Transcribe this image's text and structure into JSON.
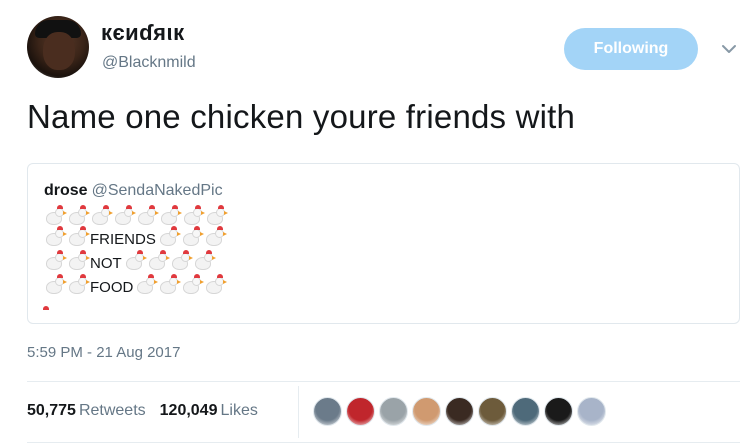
{
  "tweet": {
    "display_name": "кєиɗяιк",
    "handle": "@Blacknmild",
    "follow_label": "Following",
    "text": "Name one chicken youre friends with",
    "timestamp": "5:59 PM - 21 Aug 2017"
  },
  "quoted_tweet": {
    "name": "drose",
    "handle": "@SendaNakedPic",
    "words": [
      "FRIENDS",
      "NOT",
      "FOOD"
    ],
    "icon": "chicken-emoji"
  },
  "stats": {
    "retweets_count": "50,775",
    "retweets_label": "Retweets",
    "likes_count": "120,049",
    "likes_label": "Likes"
  },
  "likers": [
    {
      "color": "#6b7b8a"
    },
    {
      "color": "#c0262c"
    },
    {
      "color": "#9aa3a8"
    },
    {
      "color": "#d09a70"
    },
    {
      "color": "#3a2a22"
    },
    {
      "color": "#6d5b3b"
    },
    {
      "color": "#4e6a7a"
    },
    {
      "color": "#1a1a1a"
    },
    {
      "color": "#a8b4c9"
    }
  ],
  "colors": {
    "follow_button_bg": "#a3d4f7",
    "secondary_text": "#657786",
    "border": "#e1e8ed"
  }
}
